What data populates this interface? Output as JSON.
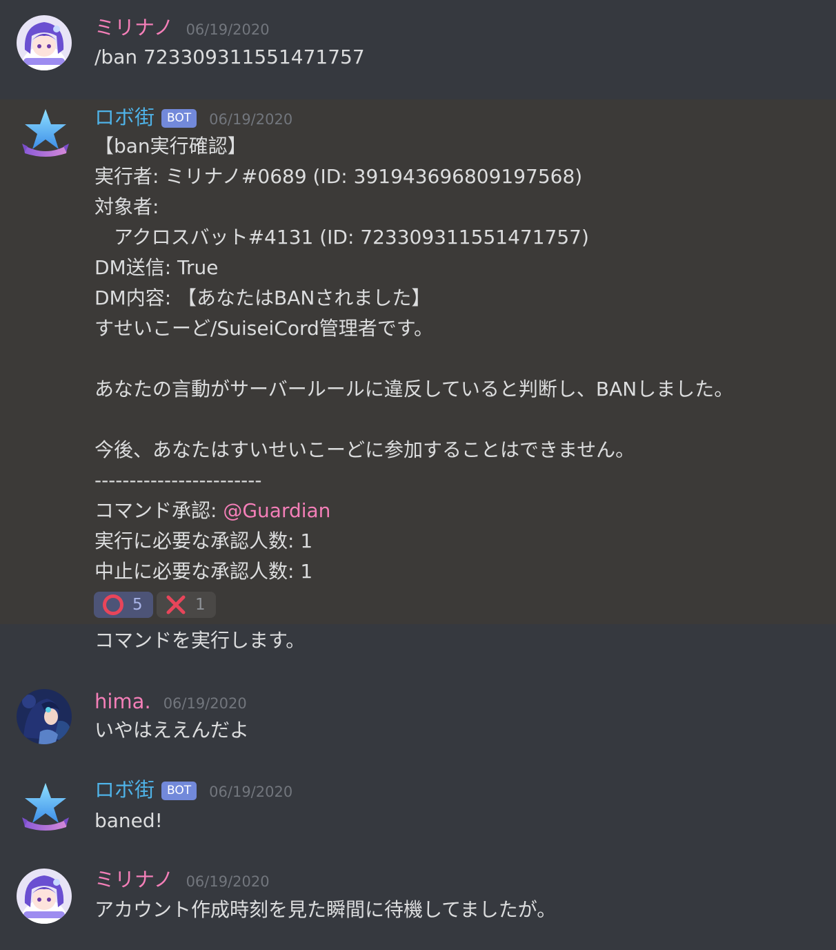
{
  "messages": [
    {
      "username": "ミリナノ",
      "username_color": "#f47fb8",
      "timestamp": "06/19/2020",
      "lines": [
        "/ban 723309311551471757"
      ]
    },
    {
      "username": "ロボ街",
      "username_color": "#4fb3e8",
      "bot_tag": "BOT",
      "timestamp": "06/19/2020",
      "lines": [
        "【ban実行確認】",
        "実行者: ミリナノ#0689 (ID: 391943696809197568)",
        "対象者:",
        "　アクロスバット#4131 (ID: 723309311551471757)",
        "DM送信: True",
        "DM内容: 【あなたはBANされました】",
        "すせいこーど/SuiseiCord管理者です。",
        "",
        "あなたの言動がサーバールールに違反していると判断し、BANしました。",
        "",
        "今後、あなたはすいせいこーどに参加することはできません。",
        "------------------------",
        "コマンド承認: ",
        "実行に必要な承認人数: 1",
        "中止に必要な承認人数: 1"
      ],
      "mention": "@Guardian",
      "reactions": [
        {
          "emoji": "circle-icon",
          "count": "5",
          "me": true
        },
        {
          "emoji": "cross-icon",
          "count": "1",
          "me": false
        }
      ],
      "followup": "コマンドを実行します。"
    },
    {
      "username": "hima.",
      "username_color": "#f47fb8",
      "timestamp": "06/19/2020",
      "lines": [
        "いやはええんだよ"
      ]
    },
    {
      "username": "ロボ街",
      "username_color": "#4fb3e8",
      "bot_tag": "BOT",
      "timestamp": "06/19/2020",
      "lines": [
        "baned!"
      ]
    },
    {
      "username": "ミリナノ",
      "username_color": "#f47fb8",
      "timestamp": "06/19/2020",
      "lines": [
        "アカウント作成時刻を見た瞬間に待機してましたが。"
      ]
    }
  ],
  "colors": {
    "background": "#36393f",
    "highlight": "#3c3a38",
    "text": "#dcddde",
    "timestamp": "#72767d",
    "bot_tag": "#7289da",
    "mention": "#f47fb8",
    "reaction_circle": "#e8455a",
    "reaction_cross": "#e8455a"
  }
}
